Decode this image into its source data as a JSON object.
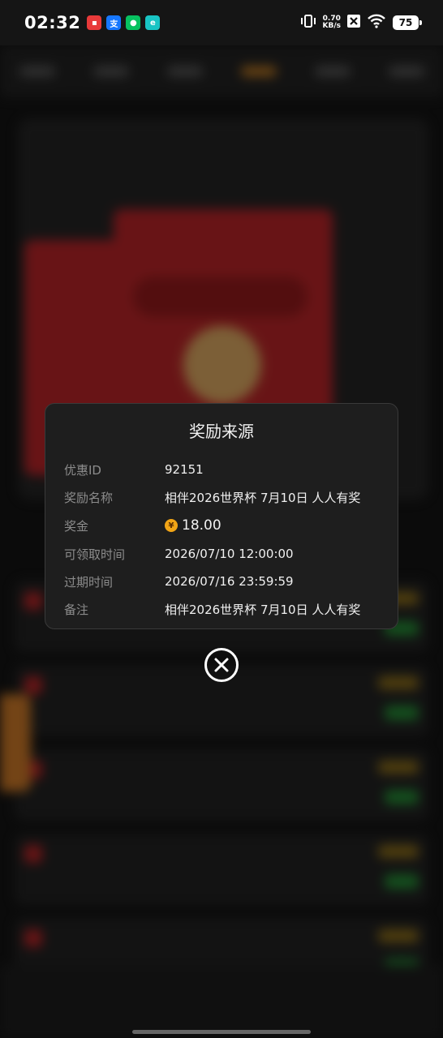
{
  "status_bar": {
    "time": "02:32",
    "net_speed_value": "0.70",
    "net_speed_unit": "KB/s",
    "battery": "75"
  },
  "dialog": {
    "title": "奖励来源",
    "rows": [
      {
        "label": "优惠ID",
        "value": "92151"
      },
      {
        "label": "奖励名称",
        "value": "相伴2026世界杯 7月10日 人人有奖"
      },
      {
        "label": "奖金",
        "value": "18.00",
        "icon": "yen-coin-icon"
      },
      {
        "label": "可领取时间",
        "value": "2026/07/10 12:00:00"
      },
      {
        "label": "过期时间",
        "value": "2026/07/16 23:59:59"
      },
      {
        "label": "备注",
        "value": "相伴2026世界杯 7月10日 人人有奖"
      }
    ],
    "close_icon": "close-circle-icon"
  },
  "colors": {
    "dialog_bg": "#1e1e1e",
    "label": "#8c8c8c",
    "value": "#f0f0f0",
    "coin": "#f2a516"
  }
}
